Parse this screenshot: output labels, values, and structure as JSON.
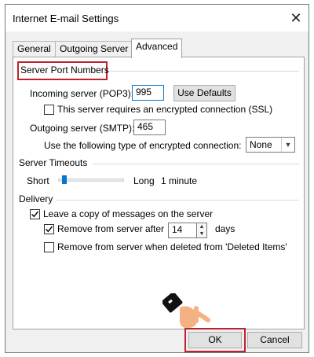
{
  "window": {
    "title": "Internet E-mail Settings",
    "close_glyph": "✕"
  },
  "tabs": [
    {
      "label": "General",
      "active": false
    },
    {
      "label": "Outgoing Server",
      "active": false
    },
    {
      "label": "Advanced",
      "active": true
    }
  ],
  "server_ports": {
    "section_label": "Server Port Numbers",
    "incoming_label": "Incoming server (POP3):",
    "incoming_value": "995",
    "use_defaults_label": "Use Defaults",
    "ssl_label": "This server requires an encrypted connection (SSL)",
    "ssl_checked": false,
    "outgoing_label": "Outgoing server (SMTP):",
    "outgoing_value": "465",
    "encryption_label": "Use the following type of encrypted connection:",
    "encryption_value": "None"
  },
  "timeouts": {
    "section_label": "Server Timeouts",
    "short_label": "Short",
    "long_label": "Long",
    "value_label": "1 minute",
    "slider_fraction": 0.1
  },
  "delivery": {
    "section_label": "Delivery",
    "leave_copy_label": "Leave a copy of messages on the server",
    "leave_copy_checked": true,
    "remove_after_label": "Remove from server after",
    "remove_after_checked": true,
    "remove_after_days": "14",
    "days_label": "days",
    "remove_deleted_label": "Remove from server when deleted from 'Deleted Items'",
    "remove_deleted_checked": false
  },
  "buttons": {
    "ok_label": "OK",
    "cancel_label": "Cancel"
  },
  "colors": {
    "highlight": "#c0212f",
    "accent": "#0078d7",
    "check": "#000000"
  },
  "icons": [
    "close-icon",
    "checkmark-icon",
    "spin-up-icon",
    "spin-down-icon",
    "dropdown-arrow-icon",
    "pointing-hand-icon"
  ]
}
